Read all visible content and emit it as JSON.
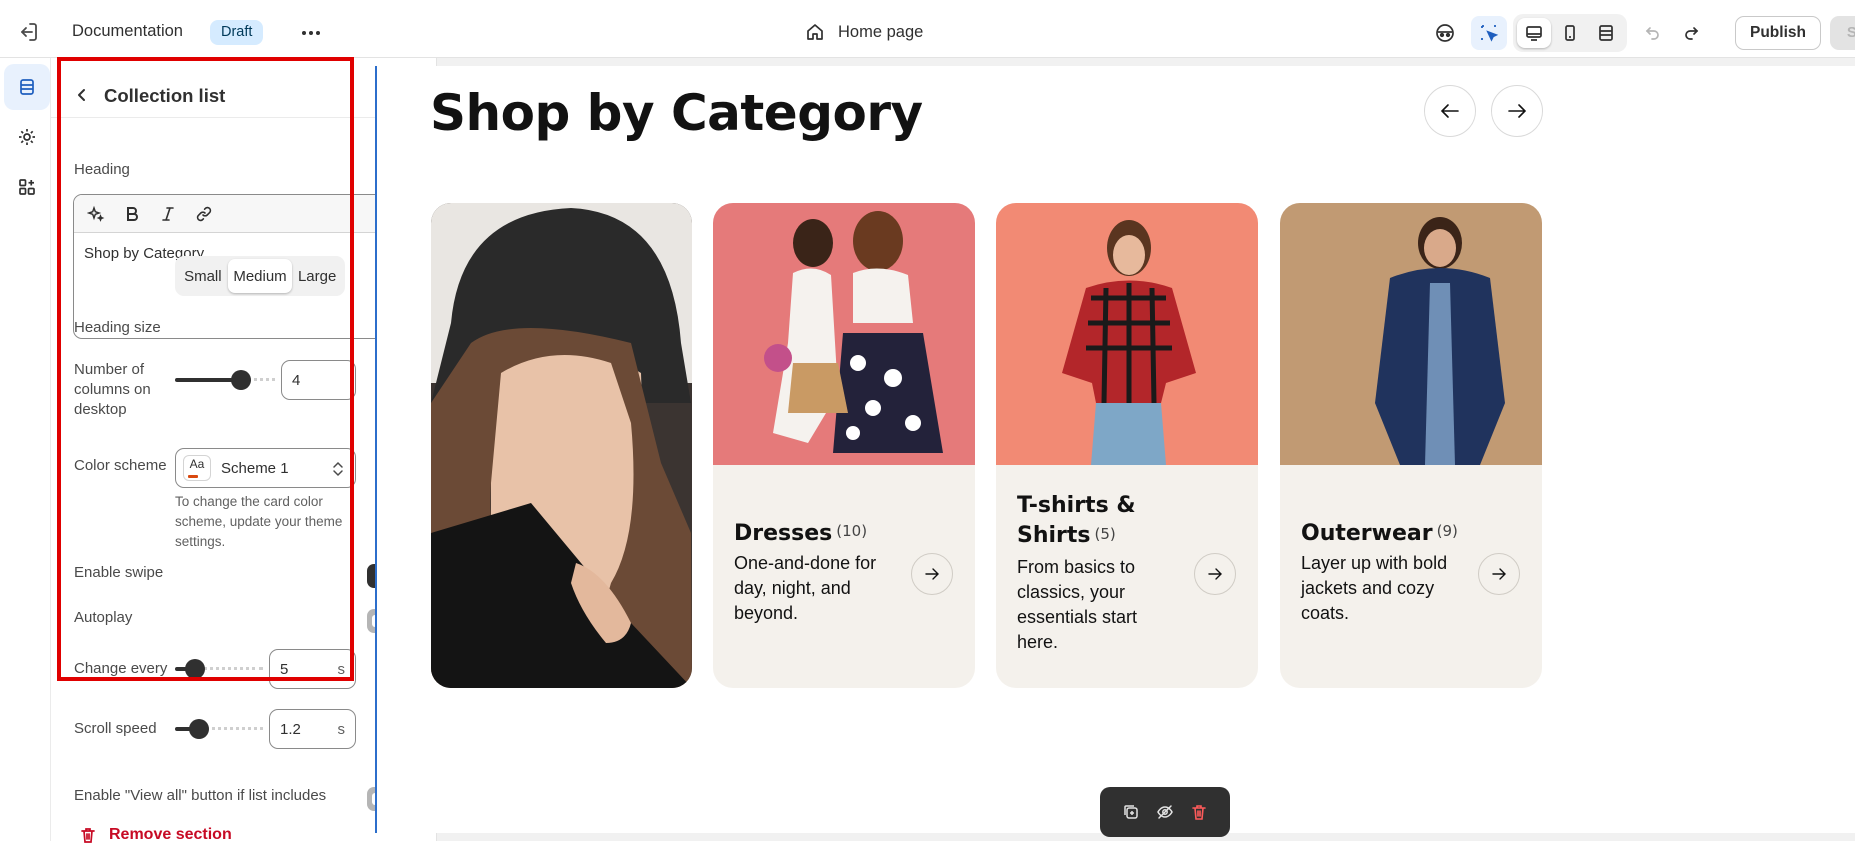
{
  "topbar": {
    "title": "Documentation",
    "badge": "Draft",
    "page_name": "Home page",
    "publish_label": "Publish",
    "save_label": "Sa"
  },
  "panel": {
    "title": "Collection list",
    "heading_label": "Heading",
    "heading_value": "Shop by Category",
    "heading_size_label": "Heading size",
    "heading_size_options": [
      "Small",
      "Medium",
      "Large"
    ],
    "heading_size_selected": "Medium",
    "columns_label_1": "Number of",
    "columns_label_2": "columns on",
    "columns_label_3": "desktop",
    "columns_value": "4",
    "color_scheme_label": "Color scheme",
    "color_scheme_swatch": "Aa",
    "color_scheme_value": "Scheme 1",
    "color_scheme_help_1": "To change the card color",
    "color_scheme_help_2": "scheme, update your theme",
    "color_scheme_help_3": "settings.",
    "enable_swipe_label": "Enable swipe",
    "enable_swipe_on": true,
    "autoplay_label": "Autoplay",
    "autoplay_on": false,
    "change_every_label": "Change every",
    "change_every_value": "5",
    "change_every_unit": "s",
    "scroll_speed_label": "Scroll speed",
    "scroll_speed_value": "1.2",
    "scroll_speed_unit": "s",
    "view_all_label": "Enable \"View all\" button if list includes",
    "remove_label": "Remove section"
  },
  "preview": {
    "section_title": "Shop by Category",
    "cards": [
      {
        "title": "",
        "count": "",
        "desc": []
      },
      {
        "title": "Dresses",
        "count": "(10)",
        "desc": [
          "One-and-done for",
          "day, night, and",
          "beyond."
        ]
      },
      {
        "title_1": "T-shirts &",
        "title_2": "Shirts",
        "count": "(5)",
        "desc": [
          "From basics to",
          "classics, your",
          "essentials start",
          "here."
        ]
      },
      {
        "title": "Outerwear",
        "count": "(9)",
        "desc": [
          "Layer up with bold",
          "jackets and cozy",
          "coats."
        ]
      }
    ]
  },
  "colors": {
    "accent": "#2c6ecb",
    "highlight_border": "#e00000",
    "remove_red": "#c70a24",
    "card_bg": "#f4f1ec"
  }
}
